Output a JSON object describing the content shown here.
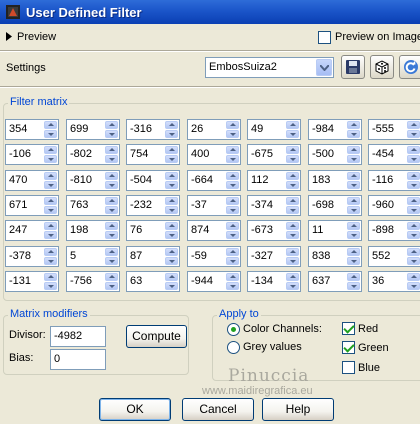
{
  "window": {
    "title": "User Defined Filter"
  },
  "preview": {
    "label": "Preview",
    "preview_on_image_label": "Preview on Image",
    "preview_on_image_checked": false
  },
  "settings": {
    "label": "Settings",
    "preset_value": "EmbosSuiza2"
  },
  "filter_matrix": {
    "title": "Filter matrix",
    "rows": [
      [
        "354",
        "699",
        "-316",
        "26",
        "49",
        "-984",
        "-555"
      ],
      [
        "-106",
        "-802",
        "754",
        "400",
        "-675",
        "-500",
        "-454"
      ],
      [
        "470",
        "-810",
        "-504",
        "-664",
        "112",
        "183",
        "-116"
      ],
      [
        "671",
        "763",
        "-232",
        "-37",
        "-374",
        "-698",
        "-960"
      ],
      [
        "247",
        "198",
        "76",
        "874",
        "-673",
        "11",
        "-898"
      ],
      [
        "-378",
        "5",
        "87",
        "-59",
        "-327",
        "838",
        "552"
      ],
      [
        "-131",
        "-756",
        "63",
        "-944",
        "-134",
        "637",
        "36"
      ]
    ]
  },
  "modifiers": {
    "title": "Matrix modifiers",
    "divisor_label": "Divisor:",
    "divisor_value": "-4982",
    "bias_label": "Bias:",
    "bias_value": "0",
    "compute_label": "Compute"
  },
  "apply_to": {
    "title": "Apply to",
    "color_channels_label": "Color Channels:",
    "grey_values_label": "Grey values",
    "selected": "color-channels",
    "red_label": "Red",
    "red_checked": true,
    "green_label": "Green",
    "green_checked": true,
    "blue_label": "Blue",
    "blue_checked": false
  },
  "watermark": {
    "name": "Pinuccia",
    "url": "www.maidiregrafica.eu"
  },
  "buttons": {
    "ok": "OK",
    "cancel": "Cancel",
    "help": "Help"
  },
  "icons": [
    "app-icon",
    "triangle-right-icon",
    "save-icon",
    "dice-icon",
    "reset-icon",
    "chevron-down-icon"
  ],
  "colors": {
    "titlebar": "#0a3fb3",
    "group_title": "#0046d5",
    "dialog_bg": "#ece9d8"
  }
}
